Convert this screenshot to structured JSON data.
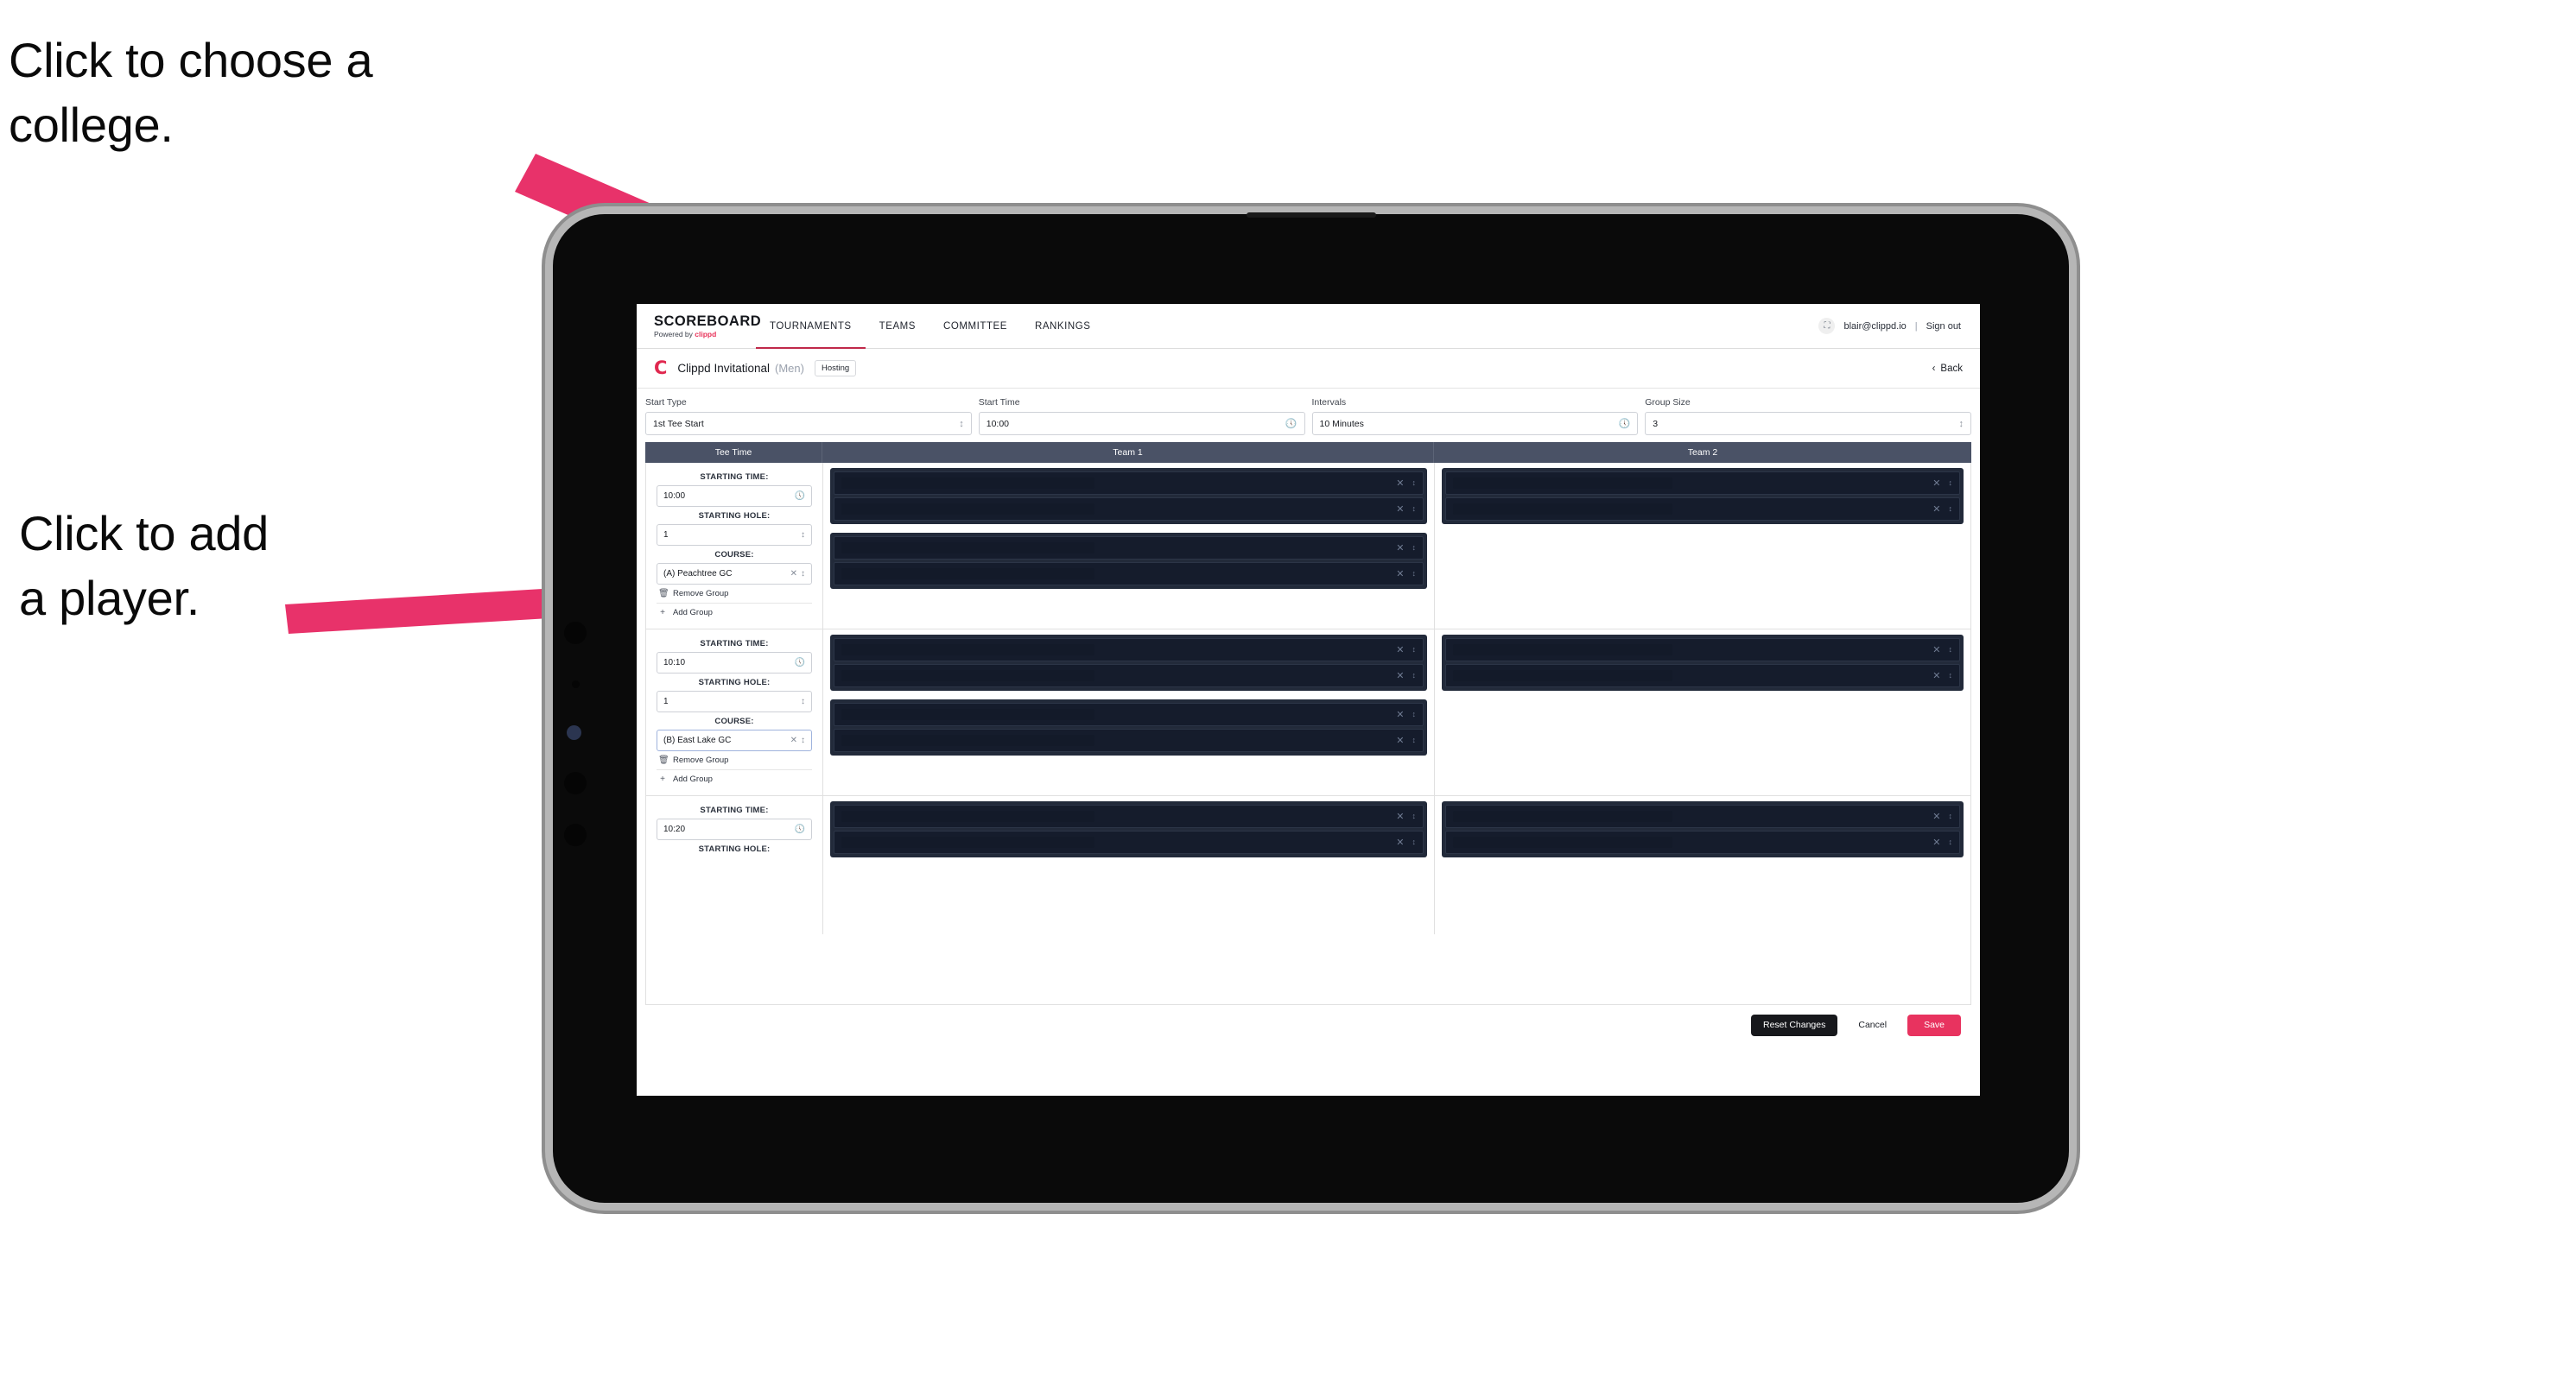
{
  "annotations": {
    "college": "Click to choose a\ncollege.",
    "player": "Click to add\na player."
  },
  "nav": {
    "brand_title": "SCOREBOARD",
    "brand_sub_prefix": "Powered by ",
    "brand_sub_name": "clippd",
    "tabs": [
      {
        "label": "TOURNAMENTS",
        "active": true
      },
      {
        "label": "TEAMS",
        "active": false
      },
      {
        "label": "COMMITTEE",
        "active": false
      },
      {
        "label": "RANKINGS",
        "active": false
      }
    ],
    "avatar_icon": "user-avatar-icon",
    "account_email": "blair@clippd.io",
    "separator": "|",
    "sign_out": "Sign out"
  },
  "tournament": {
    "logo_letter": "C",
    "name": "Clippd Invitational",
    "gender": "(Men)",
    "badge": "Hosting",
    "back_chevron": "‹",
    "back_label": "Back"
  },
  "settings": {
    "fields": [
      {
        "label": "Start Type",
        "value": "1st Tee Start",
        "adorn": "⌃⌄",
        "adorn_name": "stepper-icon"
      },
      {
        "label": "Start Time",
        "value": "10:00",
        "adorn": "◴",
        "adorn_name": "clock-icon"
      },
      {
        "label": "Intervals",
        "value": "10 Minutes",
        "adorn": "◴",
        "adorn_name": "clock-icon"
      },
      {
        "label": "Group Size",
        "value": "3",
        "adorn": "⌃⌄",
        "adorn_name": "stepper-icon"
      }
    ]
  },
  "table": {
    "headers": {
      "tee_time": "Tee Time",
      "team1": "Team 1",
      "team2": "Team 2"
    },
    "labels": {
      "starting_time": "STARTING TIME:",
      "starting_hole": "STARTING HOLE:",
      "course": "COURSE:",
      "remove_group": "Remove Group",
      "add_group": "Add Group",
      "remove_icon": "trash-icon",
      "add_icon": "plus-icon",
      "clear_icon": "clear-x-icon",
      "stepper_icon": "stepper-icon",
      "clock_icon": "clock-icon"
    },
    "groups": [
      {
        "starting_time": "10:00",
        "starting_hole": "1",
        "course": "(A) Peachtree GC",
        "course_focused": false,
        "team1_blocks": [
          {
            "slots": 2
          },
          {
            "slots": 2
          }
        ],
        "team2_blocks": [
          {
            "slots": 2
          }
        ]
      },
      {
        "starting_time": "10:10",
        "starting_hole": "1",
        "course": "(B) East Lake GC",
        "course_focused": true,
        "team1_blocks": [
          {
            "slots": 2
          },
          {
            "slots": 2
          }
        ],
        "team2_blocks": [
          {
            "slots": 2
          }
        ]
      },
      {
        "starting_time": "10:20",
        "starting_hole": "",
        "course": "",
        "course_focused": false,
        "team1_blocks": [
          {
            "slots": 2
          }
        ],
        "team2_blocks": [
          {
            "slots": 2
          }
        ]
      }
    ]
  },
  "footer": {
    "reset": "Reset Changes",
    "cancel": "Cancel",
    "save": "Save"
  },
  "colors": {
    "accent_pink": "#e8335f",
    "brand_red": "#e0284f",
    "table_header": "#4a5266",
    "slot_dark": "#151c2c",
    "annotation_arrow": "#e8326a"
  }
}
